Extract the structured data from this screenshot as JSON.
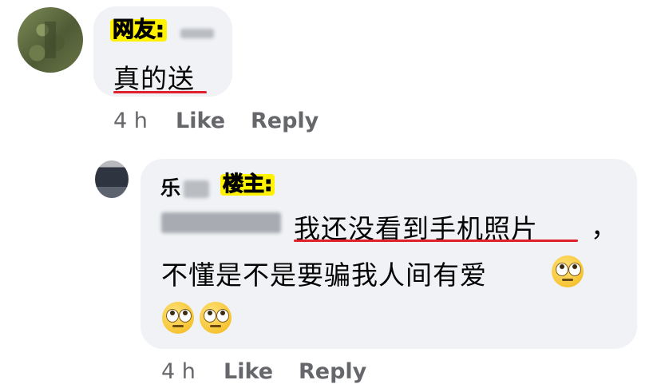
{
  "comments": [
    {
      "tag": "网友:",
      "text": "真的送",
      "time": "4 h",
      "like_label": "Like",
      "reply_label": "Reply"
    },
    {
      "name_char": "乐",
      "tag": "楼主:",
      "text_line1": "我还没看到手机照片",
      "comma": "，",
      "text_line2": "不懂是不是要骗我人间有爱",
      "time": "4 h",
      "like_label": "Like",
      "reply_label": "Reply"
    }
  ],
  "colors": {
    "bubble": "#f0f2f5",
    "tag_highlight": "#fff200",
    "underline": "#e0202b",
    "meta_text": "#65676b"
  },
  "icons": [
    "avatar-blurred",
    "eye-roll-emoji"
  ]
}
